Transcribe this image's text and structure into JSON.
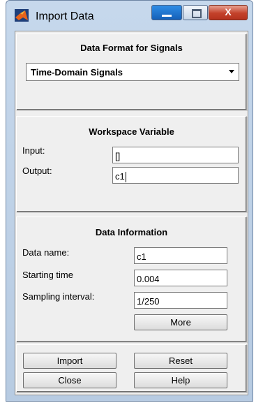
{
  "window": {
    "title": "Import Data",
    "close_glyph": "X"
  },
  "format_panel": {
    "heading": "Data Format for Signals",
    "selected": "Time-Domain Signals"
  },
  "workspace_panel": {
    "heading": "Workspace Variable",
    "input_label": "Input:",
    "input_value": "[]",
    "output_label": "Output:",
    "output_value": "c1"
  },
  "info_panel": {
    "heading": "Data Information",
    "name_label": "Data name:",
    "name_value": "c1",
    "start_label": "Starting time",
    "start_value": "0.004",
    "interval_label": "Sampling interval:",
    "interval_value": "1/250",
    "more_label": "More"
  },
  "buttons": {
    "import": "Import",
    "reset": "Reset",
    "close": "Close",
    "help": "Help"
  },
  "colors": {
    "accent_blue": "#1560b8",
    "close_red": "#c3412a",
    "panel_bg": "#efefef"
  }
}
